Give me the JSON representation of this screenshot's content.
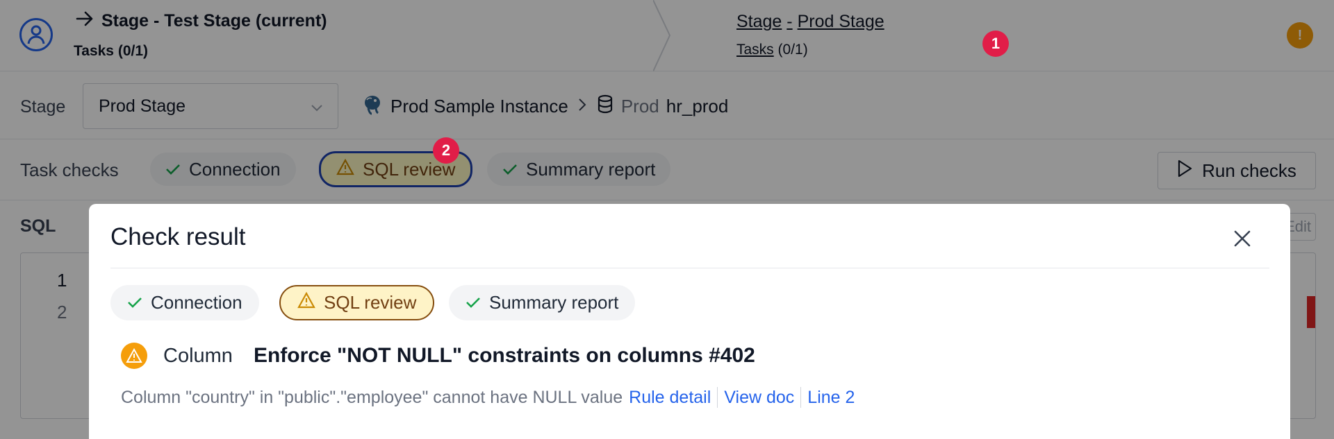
{
  "stepper": {
    "step1_title": "Stage - Test Stage (current)",
    "step1_tasks": "Tasks (0/1)",
    "step2_stage": "Stage",
    "step2_dash": "-",
    "step2_name": "Prod Stage",
    "step2_tasks_label": "Tasks",
    "step2_tasks_count": "(0/1)",
    "warning_glyph": "!"
  },
  "annotations": {
    "badge1": "1",
    "badge2": "2"
  },
  "stage_bar": {
    "label": "Stage",
    "selected": "Prod Stage",
    "instance": "Prod Sample Instance",
    "env": "Prod",
    "database": "hr_prod"
  },
  "task_checks": {
    "label": "Task checks",
    "chips": [
      {
        "label": "Connection",
        "status": "success"
      },
      {
        "label": "SQL review",
        "status": "warning"
      },
      {
        "label": "Summary report",
        "status": "success"
      }
    ],
    "run_label": "Run checks"
  },
  "sql_section": {
    "label": "SQL",
    "edit_label": "Edit",
    "line_numbers": [
      "1",
      "2"
    ]
  },
  "modal": {
    "title": "Check result",
    "chips": [
      {
        "label": "Connection",
        "status": "success"
      },
      {
        "label": "SQL review",
        "status": "warning"
      },
      {
        "label": "Summary report",
        "status": "success"
      }
    ],
    "result": {
      "category": "Column",
      "title": "Enforce \"NOT NULL\" constraints on columns #402",
      "message": "Column \"country\" in \"public\".\"employee\" cannot have NULL value",
      "links": [
        "Rule detail",
        "View doc",
        "Line 2"
      ]
    }
  },
  "colors": {
    "accent": "#2563eb",
    "warning": "#f59e0b",
    "success": "#16a34a",
    "badge": "#e11d48"
  }
}
